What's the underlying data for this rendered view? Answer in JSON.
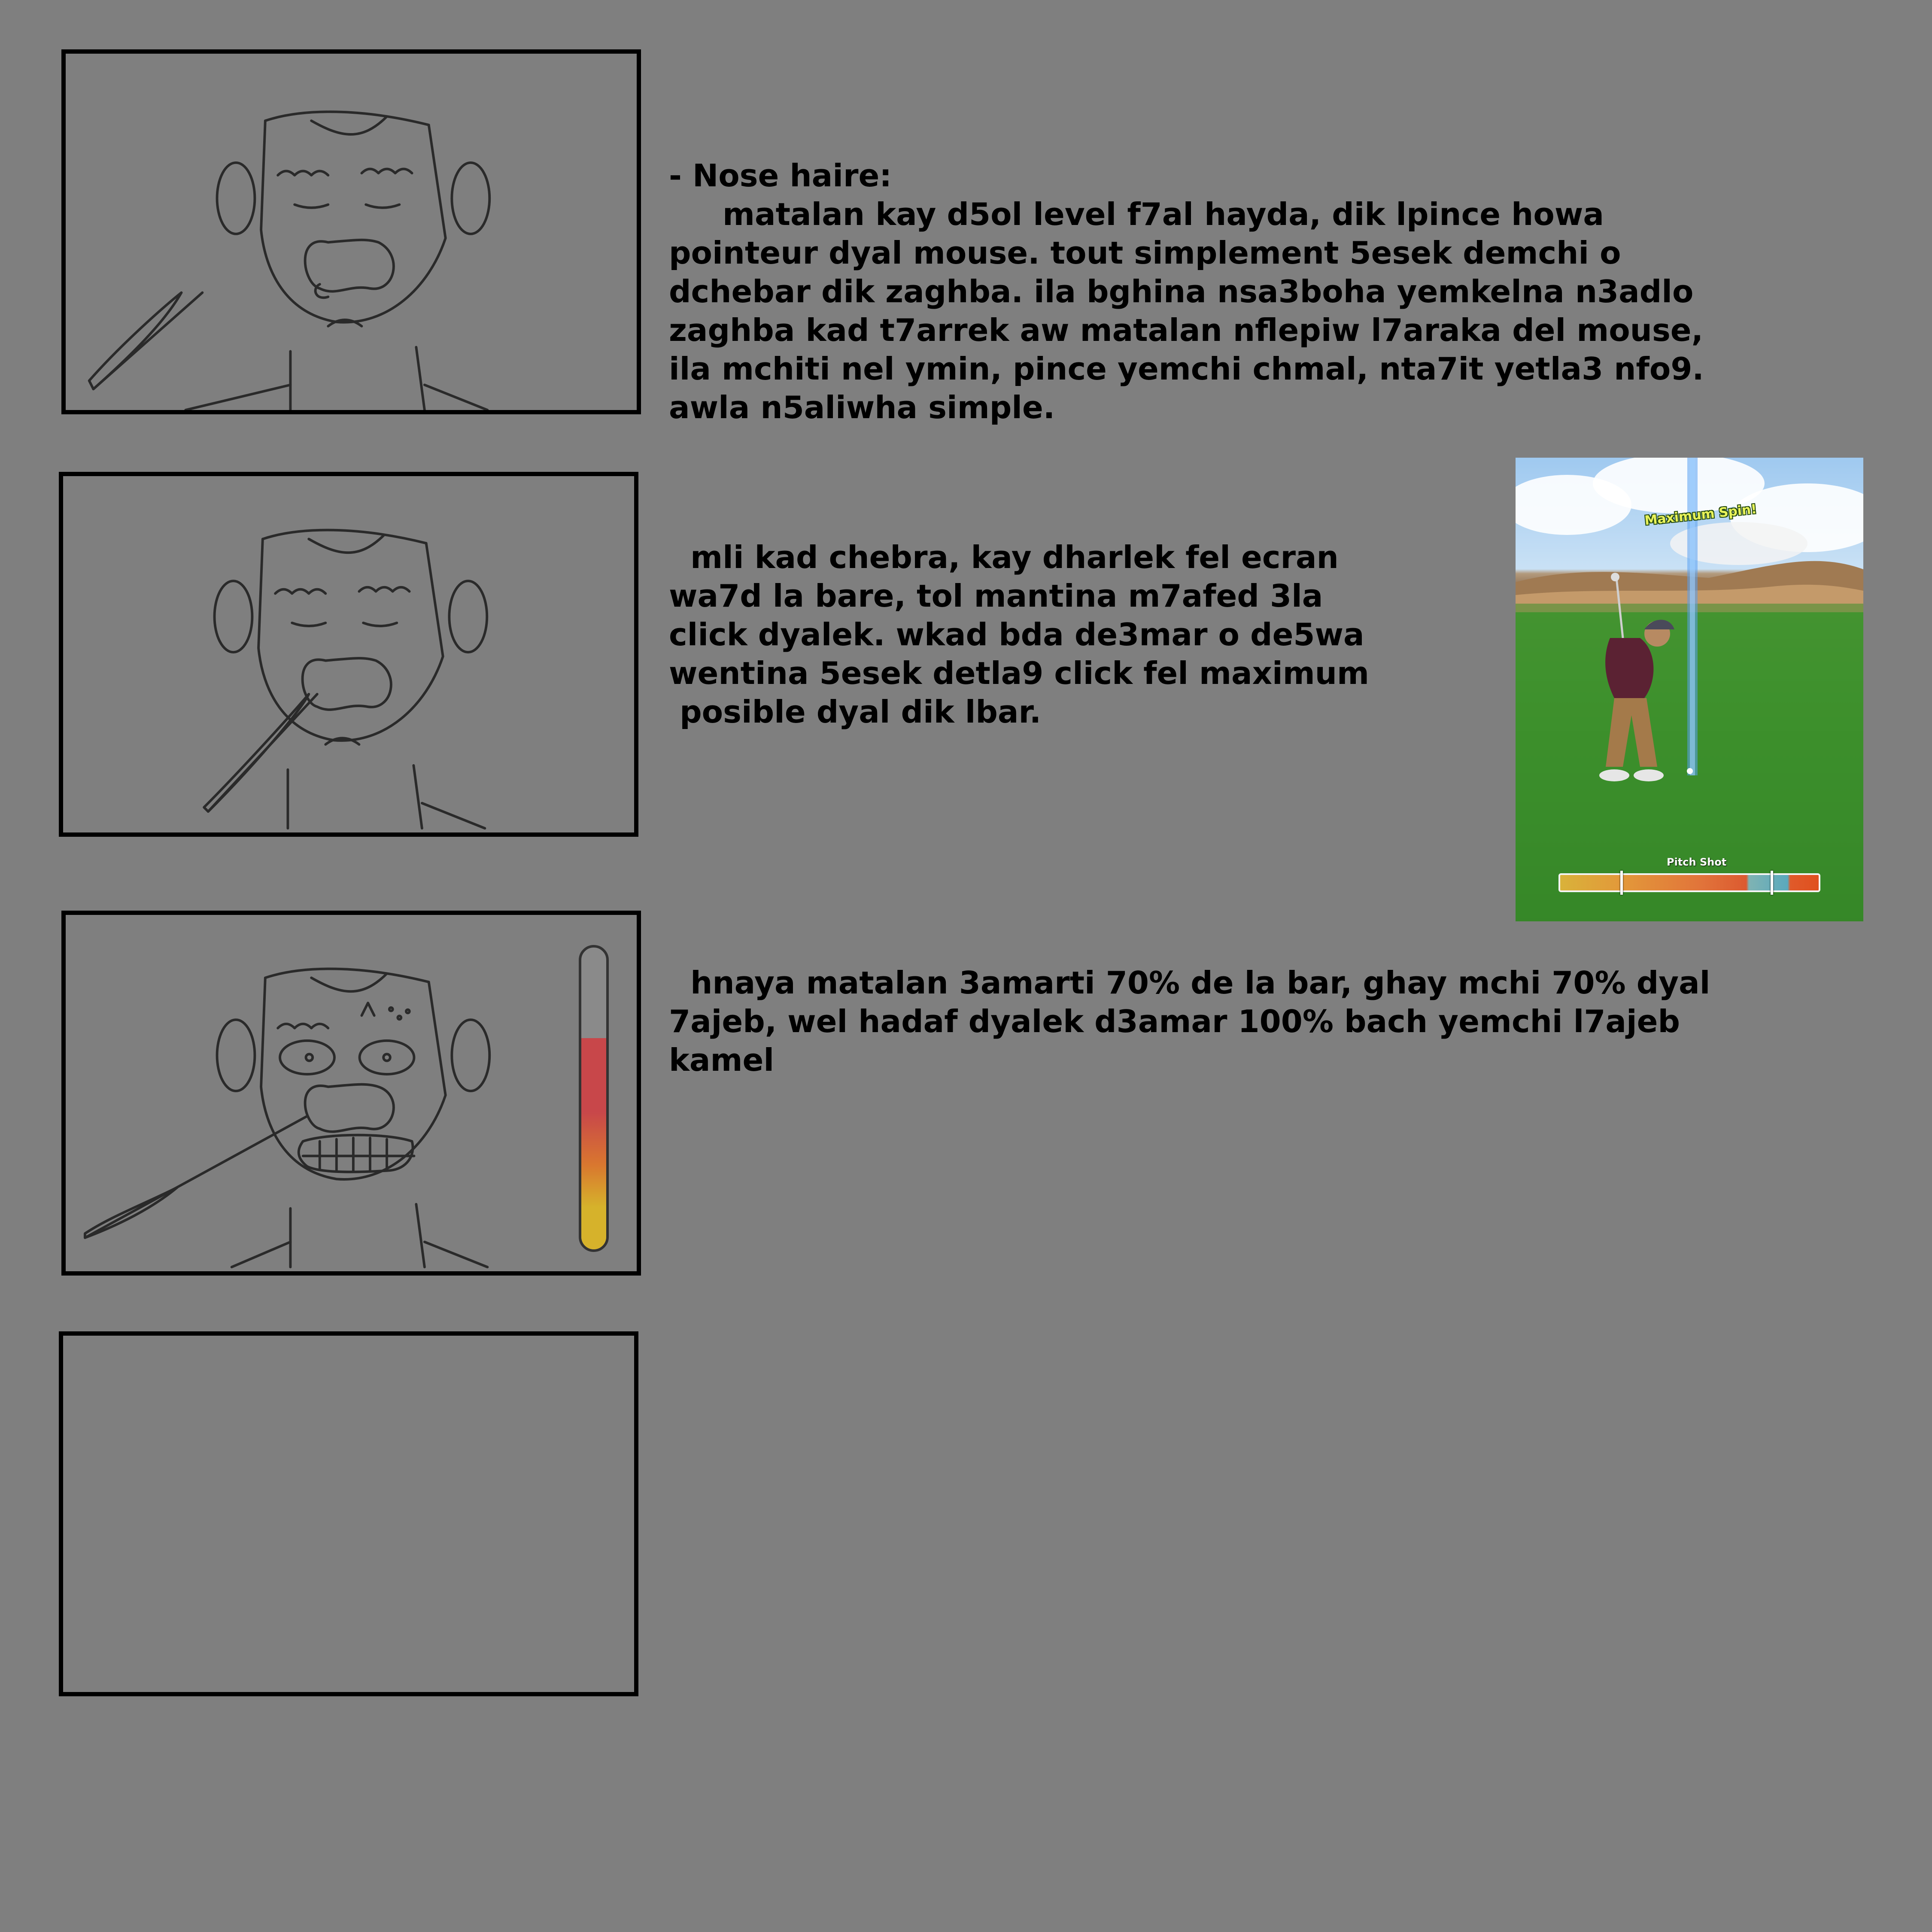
{
  "notes": {
    "note1_heading": "- Nose haire:",
    "note1_body": "matalan kay d5ol level f7al hayda, dik lpince howa\npointeur dyal mouse. tout simplement 5esek demchi o\ndchebar dik zaghba. ila bghina nsa3boha yemkelna n3adlo\nzaghba kad t7arrek aw matalan nflepiw l7araka del mouse,\nila mchiti nel ymin, pince yemchi chmal, nta7it yetla3 nfo9.\nawla n5aliwha simple.",
    "note2_body": "mli kad chebra, kay dharlek fel ecran\nwa7d la bare, tol mantina m7afed 3la\nclick dyalek. wkad bda de3mar o de5wa\nwentina 5esek detla9 click fel maximum\n posible dyal dik lbar.",
    "note3_body": "hnaya matalan 3amarti 70% de la bar, ghay mchi 70% dyal\n7ajeb, wel hadaf dyalek d3amar 100% bach yemchi l7ajeb\nkamel"
  },
  "golf_reference": {
    "spin_label": "Maximum Spin!",
    "shot_label": "Pitch Shot"
  },
  "panel3_meter": {
    "fill_level": 0.7,
    "colors": {
      "top": "#c8474a",
      "mid": "#d9772f",
      "bottom": "#d6b22b"
    }
  },
  "colors": {
    "background": "#7f7f7f",
    "ink": "#000000"
  }
}
